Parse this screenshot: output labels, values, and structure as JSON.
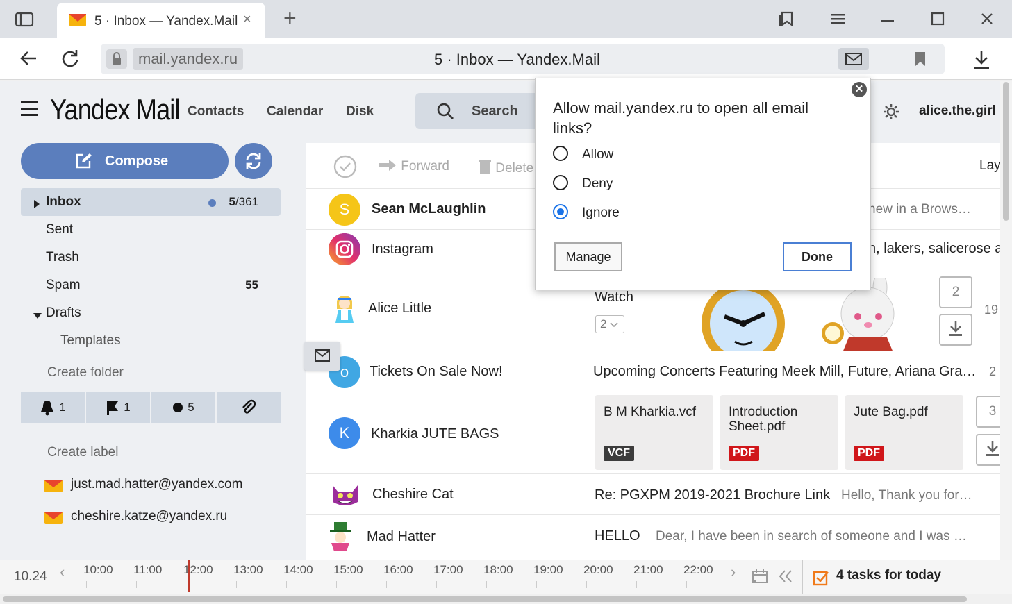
{
  "browser": {
    "tab_title": "5 · Inbox — Yandex.Mail",
    "tab_close": "×",
    "new_tab": "+",
    "domain": "mail.yandex.ru",
    "page_title": "5 · Inbox — Yandex.Mail"
  },
  "header": {
    "logo": "Yandex Mail",
    "nav": [
      "Contacts",
      "Calendar",
      "Disk"
    ],
    "search_label": "Search",
    "username": "alice.the.girl"
  },
  "sidebar": {
    "compose_label": "Compose",
    "folders": [
      {
        "label": "Inbox",
        "unread": "5",
        "total": "/361"
      },
      {
        "label": "Sent"
      },
      {
        "label": "Trash"
      },
      {
        "label": "Spam",
        "count": "55"
      },
      {
        "label": "Drafts"
      },
      {
        "label": "Templates"
      }
    ],
    "create_folder": "Create folder",
    "filters": [
      {
        "icon": "bell-icon",
        "count": "1"
      },
      {
        "icon": "flag-icon",
        "count": "1"
      },
      {
        "icon": "dot-icon",
        "count": "5"
      },
      {
        "icon": "paperclip-icon",
        "count": ""
      }
    ],
    "create_label": "Create label",
    "accounts": [
      "just.mad.hatter@yandex.com",
      "cheshire.katze@yandex.ru"
    ]
  },
  "toolbar": {
    "forward": "Forward",
    "delete": "Delete",
    "layout": "Lay"
  },
  "messages": [
    {
      "sender": "Sean McLaughlin",
      "avatar_letter": "S",
      "snippet": "new in a Brows…"
    },
    {
      "sender": "Instagram",
      "snippet": "n, lakers, salicerose a"
    },
    {
      "sender": "Alice Little",
      "subject": "Watch",
      "thread_count": "2",
      "side_count": "2",
      "date": "19"
    },
    {
      "sender": "Tickets On Sale Now!",
      "avatar_letter": "o",
      "subject": "Upcoming Concerts Featuring Meek Mill, Future, Ariana Gra…",
      "date": "2"
    },
    {
      "sender": "Kharkia JUTE BAGS",
      "avatar_letter": "K",
      "side_count": "3",
      "attachments": [
        {
          "name": "B M Kharkia.vcf",
          "type": "VCF"
        },
        {
          "name": "Introduction Sheet.pdf",
          "type": "PDF"
        },
        {
          "name": "Jute Bag.pdf",
          "type": "PDF"
        }
      ]
    },
    {
      "sender": "Cheshire Cat",
      "subject": "Re: PGXPM 2019-2021 Brochure Link",
      "snippet": "Hello, Thank you for…"
    },
    {
      "sender": "Mad Hatter",
      "subject": "HELLO",
      "snippet": "Dear, I have been in search of someone and I was …"
    }
  ],
  "popup": {
    "title": "Allow mail.yandex.ru to open all email links?",
    "options": [
      "Allow",
      "Deny",
      "Ignore"
    ],
    "selected": "Ignore",
    "manage": "Manage",
    "done": "Done"
  },
  "timeline": {
    "date": "10.24",
    "hours": [
      "10:00",
      "11:00",
      "12:00",
      "13:00",
      "14:00",
      "15:00",
      "16:00",
      "17:00",
      "18:00",
      "19:00",
      "20:00",
      "21:00",
      "22:00"
    ],
    "tasks": "4 tasks for today"
  },
  "colors": {
    "accent": "#5b7ebd",
    "pdf_badge": "#d0161a",
    "vcf_badge": "#3c3c3c",
    "now_line": "#c0392b"
  }
}
